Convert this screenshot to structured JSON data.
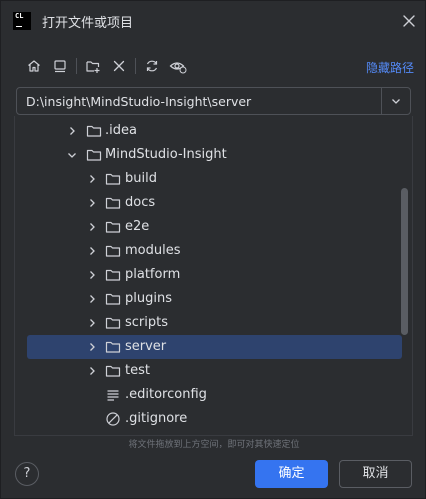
{
  "title_bar": {
    "app_logo_text": "CL",
    "title": "打开文件或项目",
    "close_icon": "close-icon"
  },
  "toolbar": {
    "buttons": [
      {
        "name": "home-icon"
      },
      {
        "name": "desktop-icon"
      },
      {
        "name": "new-folder-icon"
      },
      {
        "name": "delete-icon"
      },
      {
        "name": "refresh-icon"
      },
      {
        "name": "show-hidden-icon"
      }
    ],
    "hide_path_label": "隐藏路径"
  },
  "path": {
    "value": "D:\\insight\\MindStudio-Insight\\server",
    "dropdown_icon": "chevron-down-icon"
  },
  "tree": {
    "items": [
      {
        "label": ".idea",
        "type": "folder",
        "expanded": false
      },
      {
        "label": "MindStudio-Insight",
        "type": "folder",
        "expanded": true
      },
      {
        "label": "build",
        "type": "folder",
        "expanded": false
      },
      {
        "label": "docs",
        "type": "folder",
        "expanded": false
      },
      {
        "label": "e2e",
        "type": "folder",
        "expanded": false
      },
      {
        "label": "modules",
        "type": "folder",
        "expanded": false
      },
      {
        "label": "platform",
        "type": "folder",
        "expanded": false
      },
      {
        "label": "plugins",
        "type": "folder",
        "expanded": false
      },
      {
        "label": "scripts",
        "type": "folder",
        "expanded": false
      },
      {
        "label": "server",
        "type": "folder",
        "expanded": false,
        "selected": true
      },
      {
        "label": "test",
        "type": "folder",
        "expanded": false
      },
      {
        "label": ".editorconfig",
        "type": "file"
      },
      {
        "label": ".gitignore",
        "type": "file"
      }
    ]
  },
  "hint": "将文件拖放到上方空间，即可对其快速定位",
  "footer": {
    "help_label": "?",
    "ok_label": "确定",
    "cancel_label": "取消"
  },
  "colors": {
    "background": "#2b2d30",
    "selection": "#2e436e",
    "accent": "#3574f0",
    "link": "#548af7"
  }
}
